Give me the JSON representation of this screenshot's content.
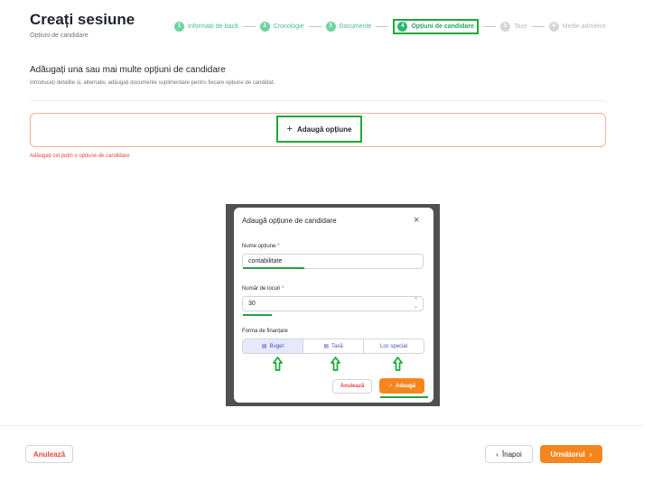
{
  "header": {
    "title": "Creați sesiune",
    "subtitle": "Opțiuni de candidare"
  },
  "stepper": {
    "steps": [
      {
        "num": "1",
        "label": "Informații de bază",
        "state": "done"
      },
      {
        "num": "2",
        "label": "Cronologie",
        "state": "done"
      },
      {
        "num": "3",
        "label": "Documente",
        "state": "done"
      },
      {
        "num": "4",
        "label": "Opțiuni de candidare",
        "state": "active"
      },
      {
        "num": "5",
        "label": "Taxe",
        "state": "future"
      },
      {
        "num": "6",
        "label": "Medie admitere",
        "state": "future"
      }
    ]
  },
  "section": {
    "title": "Adăugați una sau mai multe opțiuni de candidare",
    "description": "Introduceți detaliile și, alternativ, adăugați documente suplimentare pentru fiecare opțiune de candidat.",
    "add_button_icon": "+",
    "add_button_label": "Adaugă opțiune",
    "error": "Adăugați cel puțin o opțiune de candidare"
  },
  "modal": {
    "title": "Adaugă opțiune de candidare",
    "close_icon": "×",
    "name_label": "Nume opțiune",
    "name_value": "contabilitate",
    "seats_label": "Număr de locuri",
    "seats_value": "30",
    "required_mark": "*",
    "funding_label": "Forma de finanțare",
    "funding_options": [
      {
        "label": "Buget",
        "icon": "▤",
        "selected": true
      },
      {
        "label": "Taxă",
        "icon": "▤",
        "selected": false
      },
      {
        "label": "Loc special",
        "icon": "",
        "selected": false
      }
    ],
    "cancel_label": "Anulează",
    "add_icon": "✓",
    "add_label": "Adaugă"
  },
  "footer": {
    "cancel_label": "Anulează",
    "back_icon": "‹",
    "back_label": "Înapoi",
    "next_label": "Următorul",
    "next_icon": "›"
  },
  "colors": {
    "accent_orange": "#f5851f",
    "step_green": "#2bb673",
    "annotation_green": "#1fa83a",
    "error_red": "#e0473e",
    "segment_blue": "#4752c4"
  }
}
